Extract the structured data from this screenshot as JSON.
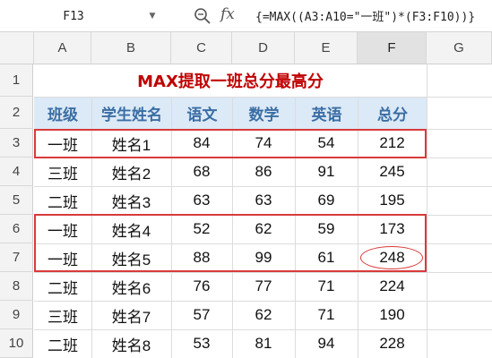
{
  "formula_bar": {
    "name_box": "F13",
    "fx_label": "fx",
    "formula": "{=MAX((A3:A10=\"一班\")*(F3:F10))}"
  },
  "columns": [
    "A",
    "B",
    "C",
    "D",
    "E",
    "F",
    "G"
  ],
  "rows": [
    "1",
    "2",
    "3",
    "4",
    "5",
    "6",
    "7",
    "8",
    "9",
    "10"
  ],
  "sheet": {
    "title": "MAX提取一班总分最高分",
    "headers": [
      "班级",
      "学生姓名",
      "语文",
      "数学",
      "英语",
      "总分"
    ],
    "data": [
      [
        "一班",
        "姓名1",
        "84",
        "74",
        "54",
        "212"
      ],
      [
        "三班",
        "姓名2",
        "68",
        "86",
        "91",
        "245"
      ],
      [
        "二班",
        "姓名3",
        "63",
        "63",
        "69",
        "195"
      ],
      [
        "一班",
        "姓名4",
        "52",
        "62",
        "59",
        "173"
      ],
      [
        "一班",
        "姓名5",
        "88",
        "99",
        "61",
        "248"
      ],
      [
        "二班",
        "姓名6",
        "76",
        "77",
        "71",
        "224"
      ],
      [
        "三班",
        "姓名7",
        "57",
        "62",
        "71",
        "190"
      ],
      [
        "二班",
        "姓名8",
        "53",
        "81",
        "94",
        "228"
      ]
    ]
  },
  "colors": {
    "title": "#c00000",
    "header_fill": "#dce9f6",
    "header_text": "#3a6ea5",
    "highlight": "#d93a3a"
  }
}
